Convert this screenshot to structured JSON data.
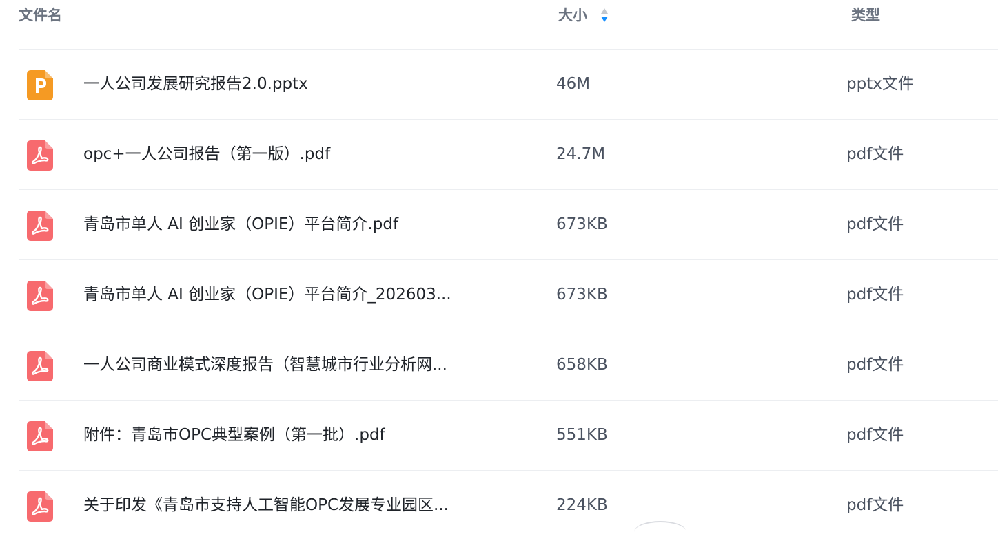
{
  "header": {
    "name": "文件名",
    "size": "大小",
    "type": "类型"
  },
  "colors": {
    "pptx_icon": "#f59a23",
    "pdf_icon": "#f76a6e",
    "sort_active": "#1890ff",
    "sort_inactive": "#c4c8ce"
  },
  "files": [
    {
      "icon": "pptx-file-icon",
      "name": "一人公司发展研究报告2.0.pptx",
      "size": "46M",
      "type": "pptx文件"
    },
    {
      "icon": "pdf-file-icon",
      "name": "opc+一人公司报告（第一版）.pdf",
      "size": "24.7M",
      "type": "pdf文件"
    },
    {
      "icon": "pdf-file-icon",
      "name": "青岛市单人 AI 创业家（OPIE）平台简介.pdf",
      "size": "673KB",
      "type": "pdf文件"
    },
    {
      "icon": "pdf-file-icon",
      "name": "青岛市单人 AI 创业家（OPIE）平台简介_202603...",
      "size": "673KB",
      "type": "pdf文件"
    },
    {
      "icon": "pdf-file-icon",
      "name": "一人公司商业模式深度报告（智慧城市行业分析网...",
      "size": "658KB",
      "type": "pdf文件"
    },
    {
      "icon": "pdf-file-icon",
      "name": "附件：青岛市OPC典型案例（第一批）.pdf",
      "size": "551KB",
      "type": "pdf文件"
    },
    {
      "icon": "pdf-file-icon",
      "name": "关于印发《青岛市支持人工智能OPC发展专业园区...",
      "size": "224KB",
      "type": "pdf文件"
    }
  ]
}
